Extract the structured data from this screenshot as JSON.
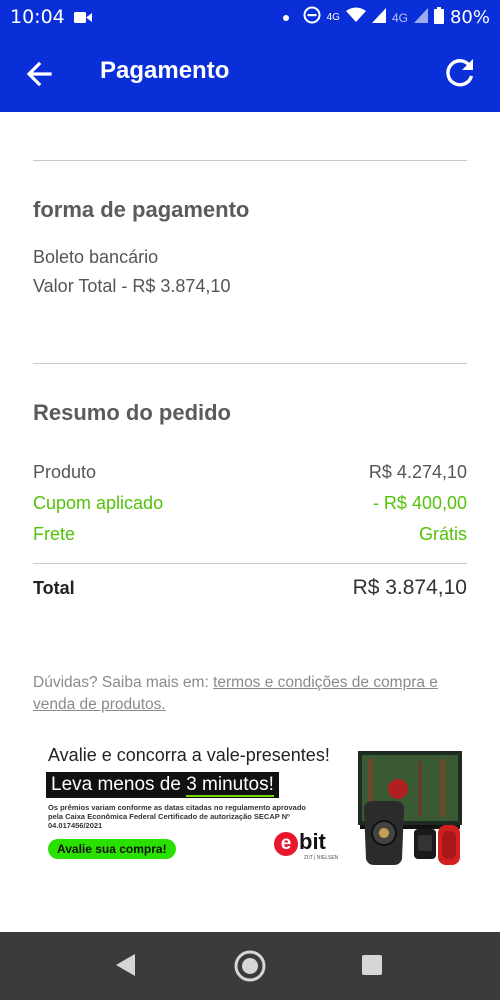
{
  "status_bar": {
    "time": "10:04",
    "network": "4G",
    "network2": "4G",
    "battery": "80%"
  },
  "app_bar": {
    "title": "Pagamento"
  },
  "payment": {
    "section_title": "forma de pagamento",
    "method": "Boleto bancário",
    "total_line": "Valor Total - R$ 3.874,10"
  },
  "summary": {
    "section_title": "Resumo do pedido",
    "rows": [
      {
        "label": "Produto",
        "value": "R$ 4.274,10"
      },
      {
        "label": "Cupom aplicado",
        "value": "- R$ 400,00"
      },
      {
        "label": "Frete",
        "value": "Grátis"
      }
    ],
    "total_label": "Total",
    "total_value": "R$ 3.874,10"
  },
  "help": {
    "prefix": "Dúvidas? Saiba mais em: ",
    "link": "termos e condições de compra e venda de produtos."
  },
  "banner": {
    "headline": "Avalie e concorra a vale-presentes!",
    "strip_prefix": "Leva menos de ",
    "strip_highlight": "3 minutos!",
    "fine_print": "Os prêmios variam conforme as datas citadas no regulamento aprovado pela Caixa Econômica Federal Certificado de autorização SECAP Nº 04.017456/2021",
    "button": "Avalie sua compra!",
    "brand_e": "e",
    "brand_rest": "bit",
    "brand_sub": "ZIIT | NIELSEN"
  },
  "colors": {
    "primary": "#0a2fd9",
    "discount_green": "#52c20a",
    "nav_bar": "#3b3b3b"
  }
}
